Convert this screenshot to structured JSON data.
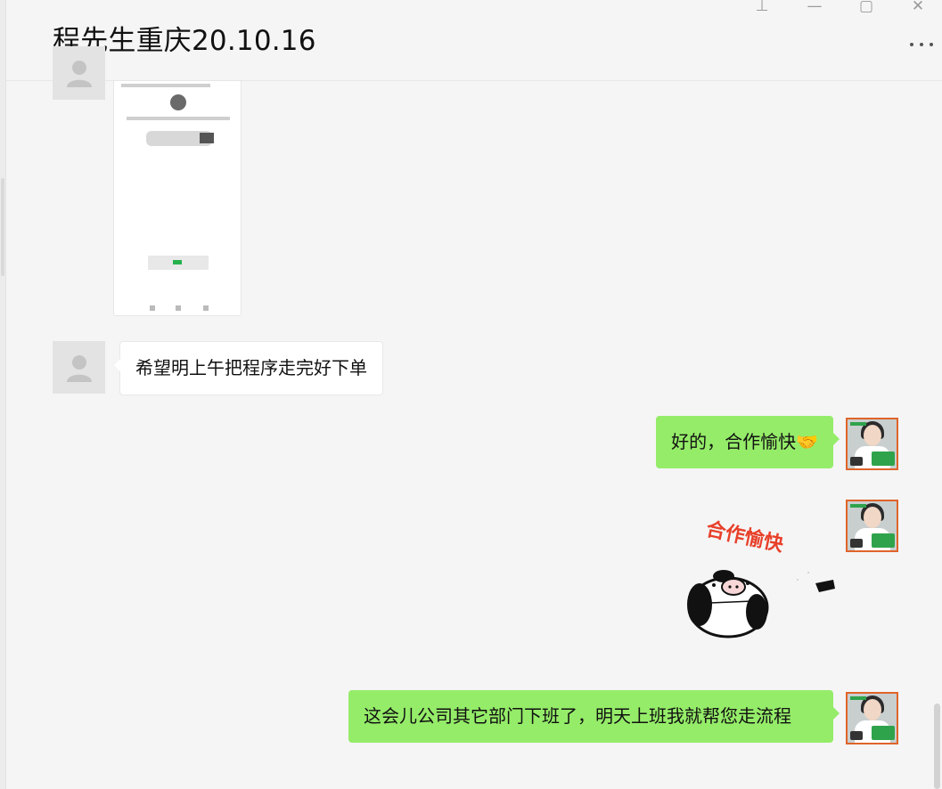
{
  "window": {
    "title": "程先生重庆20.10.16",
    "controls": {
      "pin": "⊥",
      "minimize": "—",
      "maximize": "▢",
      "close": "✕"
    }
  },
  "messages": [
    {
      "side": "left",
      "type": "image",
      "description_label": ""
    },
    {
      "side": "left",
      "type": "text",
      "text": "希望明上午把程序走完好下单"
    },
    {
      "side": "right",
      "type": "text",
      "text": "好的，合作愉快",
      "emoji": "🤝"
    },
    {
      "side": "right",
      "type": "sticker",
      "sticker_text": "合作愉快"
    },
    {
      "side": "right",
      "type": "text",
      "text": "这会儿公司其它部门下班了，明天上班我就帮您走流程"
    }
  ],
  "colors": {
    "bubble_self": "#95ec69",
    "bubble_other": "#ffffff",
    "background": "#f5f5f5",
    "sticker_text": "#e8402a"
  }
}
